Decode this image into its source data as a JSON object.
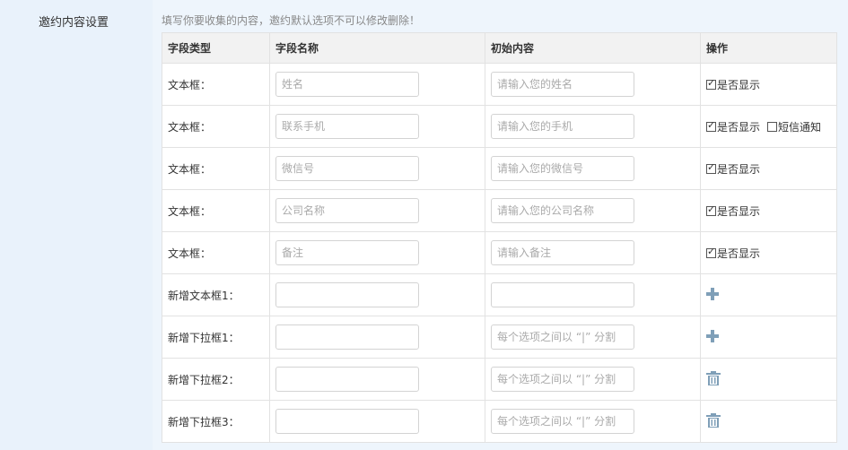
{
  "section_label": "邀约内容设置",
  "hint": "填写你要收集的内容，邀约默认选项不可以修改删除！",
  "table": {
    "headers": [
      "字段类型",
      "字段名称",
      "初始内容",
      "操作"
    ],
    "rows": [
      {
        "type": "文本框：",
        "name_placeholder": "姓名",
        "content_placeholder": "请输入您的姓名",
        "action": "display",
        "display_label": "是否显示",
        "display_checked": true
      },
      {
        "type": "文本框：",
        "name_placeholder": "联系手机",
        "content_placeholder": "请输入您的手机",
        "action": "display_sms",
        "display_label": "是否显示",
        "display_checked": true,
        "sms_label": "短信通知",
        "sms_checked": false
      },
      {
        "type": "文本框：",
        "name_placeholder": "微信号",
        "content_placeholder": "请输入您的微信号",
        "action": "display",
        "display_label": "是否显示",
        "display_checked": true
      },
      {
        "type": "文本框：",
        "name_placeholder": "公司名称",
        "content_placeholder": "请输入您的公司名称",
        "action": "display",
        "display_label": "是否显示",
        "display_checked": true
      },
      {
        "type": "文本框：",
        "name_placeholder": "备注",
        "content_placeholder": "请输入备注",
        "action": "display",
        "display_label": "是否显示",
        "display_checked": true
      },
      {
        "type": "新增文本框1：",
        "name_placeholder": "",
        "content_placeholder": "",
        "action": "add",
        "icon": "plus-icon"
      },
      {
        "type": "新增下拉框1：",
        "name_placeholder": "",
        "content_placeholder": "每个选项之间以 “|” 分割",
        "action": "add",
        "icon": "plus-icon"
      },
      {
        "type": "新增下拉框2：",
        "name_placeholder": "",
        "content_placeholder": "每个选项之间以 “|” 分割",
        "action": "delete",
        "icon": "trash-icon"
      },
      {
        "type": "新增下拉框3：",
        "name_placeholder": "",
        "content_placeholder": "每个选项之间以 “|” 分割",
        "action": "delete",
        "icon": "trash-icon"
      }
    ]
  },
  "colors": {
    "icon": "#7f9fb8",
    "header_bg": "#f2f2f2",
    "page_bg": "#e9f2fb"
  }
}
